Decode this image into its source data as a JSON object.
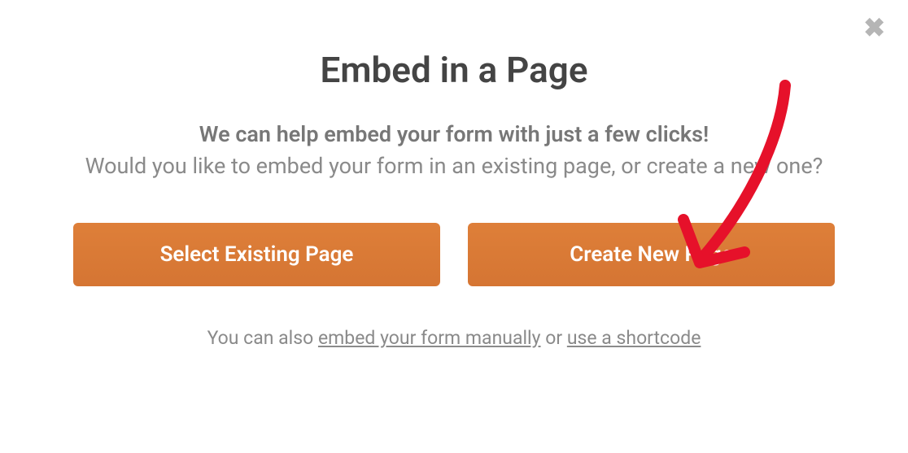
{
  "modal": {
    "title": "Embed in a Page",
    "subtitle_bold": "We can help embed your form with just a few clicks!",
    "subtitle_plain": "Would you like to embed your form in an existing page, or create a new one?",
    "buttons": {
      "select_existing": "Select Existing Page",
      "create_new": "Create New Page"
    },
    "footer": {
      "prefix": "You can also ",
      "link1": "embed your form manually",
      "separator": " or ",
      "link2": "use a shortcode"
    }
  }
}
